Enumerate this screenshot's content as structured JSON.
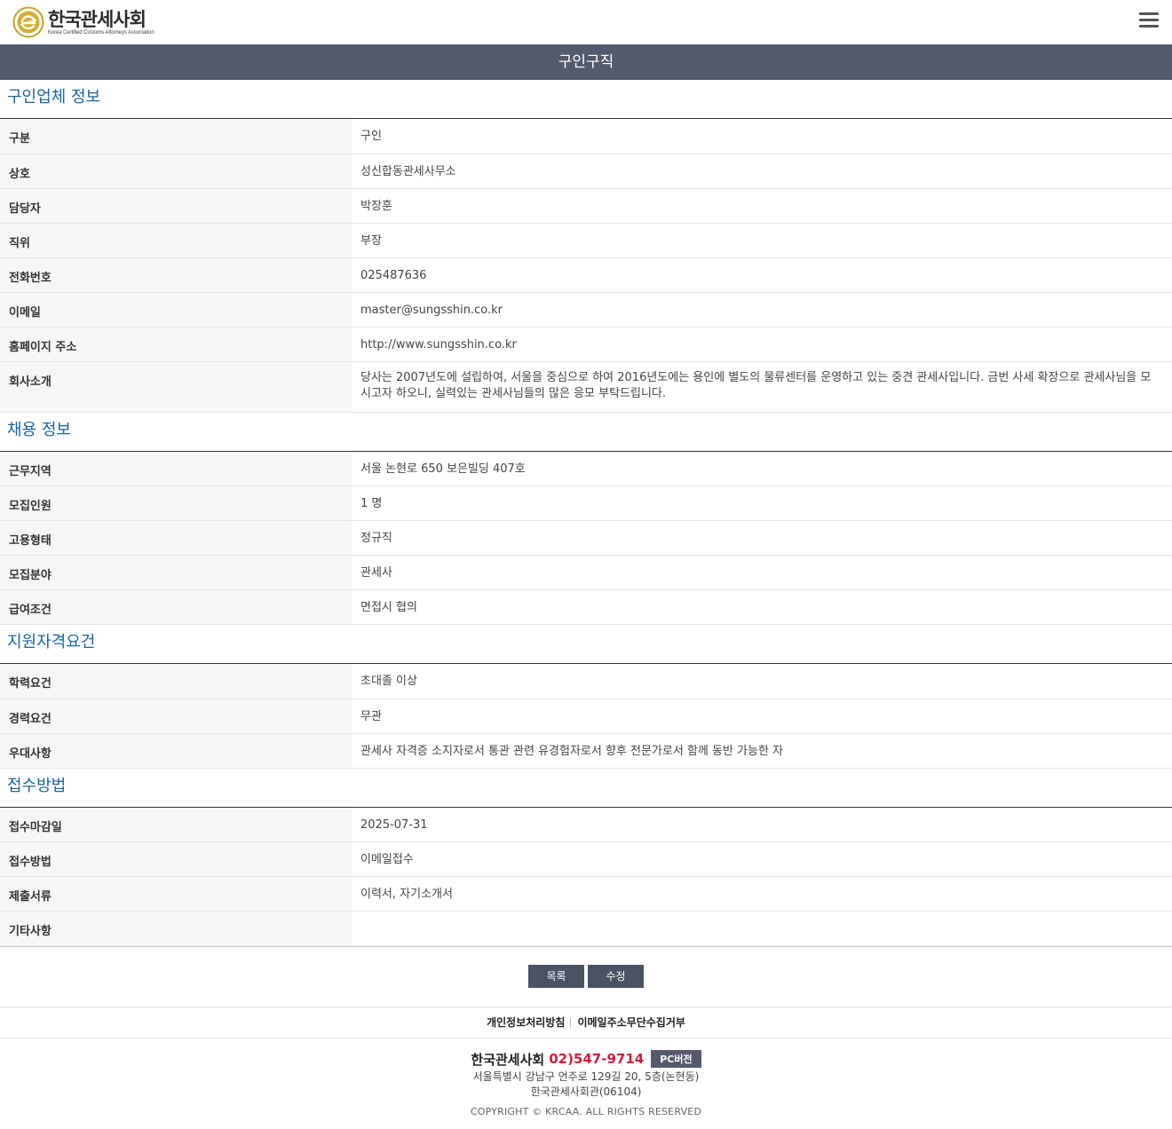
{
  "header": {
    "logo_name": "한국관세사회",
    "logo_sub": "Korea Certified Customs Attorneys Association",
    "menu_icon": "hamburger-menu-icon"
  },
  "page_title": "구인구직",
  "sections": {
    "company": {
      "title": "구인업체 정보",
      "rows": [
        {
          "label": "구분",
          "value": "구인"
        },
        {
          "label": "상호",
          "value": "성신합동관세사무소"
        },
        {
          "label": "담당자",
          "value": "박장훈"
        },
        {
          "label": "직위",
          "value": "부장"
        },
        {
          "label": "전화번호",
          "value": "025487636"
        },
        {
          "label": "이메일",
          "value": "master@sungsshin.co.kr"
        },
        {
          "label": "홈페이지 주소",
          "value": "http://www.sungsshin.co.kr"
        },
        {
          "label": "회사소개",
          "value": "당사는 2007년도에 설립하여, 서울을 중심으로 하여 2016년도에는 용인에 별도의 물류센터를 운영하고 있는 중견 관세사입니다. 금번 사세 확장으로 관세사님을 모시고자 하오니, 실력있는 관세사님들의 많은 응모 부탁드립니다."
        }
      ]
    },
    "recruit": {
      "title": "채용 정보",
      "rows": [
        {
          "label": "근무지역",
          "value": "서울 논현로 650 보은빌딩 407호"
        },
        {
          "label": "모집인원",
          "value": "1 명"
        },
        {
          "label": "고용형태",
          "value": "정규직"
        },
        {
          "label": "모집분야",
          "value": "관세사"
        },
        {
          "label": "급여조건",
          "value": "면접시 협의"
        }
      ]
    },
    "qualification": {
      "title": "지원자격요건",
      "rows": [
        {
          "label": "학력요건",
          "value": "초대졸 이상"
        },
        {
          "label": "경력요건",
          "value": "무관"
        },
        {
          "label": "우대사항",
          "value": "관세사 자격증 소지자로서 통관 관련 유경험자로서 향후 전문가로서 함께 동반 가능한 자"
        }
      ]
    },
    "apply": {
      "title": "접수방법",
      "rows": [
        {
          "label": "접수마감일",
          "value": "2025-07-31"
        },
        {
          "label": "접수방법",
          "value": "이메일접수"
        },
        {
          "label": "제출서류",
          "value": "이력서, 자기소개서"
        },
        {
          "label": "기타사항",
          "value": ""
        }
      ]
    }
  },
  "buttons": {
    "list": "목록",
    "edit": "수정"
  },
  "footer": {
    "links": [
      "개인정보처리방침",
      "이메일주소무단수집거부"
    ],
    "separator": "|",
    "org": "한국관세사회",
    "phone": "02)547-9714",
    "pc_version": "PC버전",
    "address1": "서울특별시 강남구 언주로 129길 20, 5층(논현동)",
    "address2": "한국관세사회관(06104)",
    "copyright": "COPYRIGHT © KRCAA. ALL RIGHTS RESERVED"
  },
  "colors": {
    "title_bar": "#555b6e",
    "section_title": "#1a63a8",
    "phone": "#d81b3a",
    "button": "#4b5263"
  }
}
